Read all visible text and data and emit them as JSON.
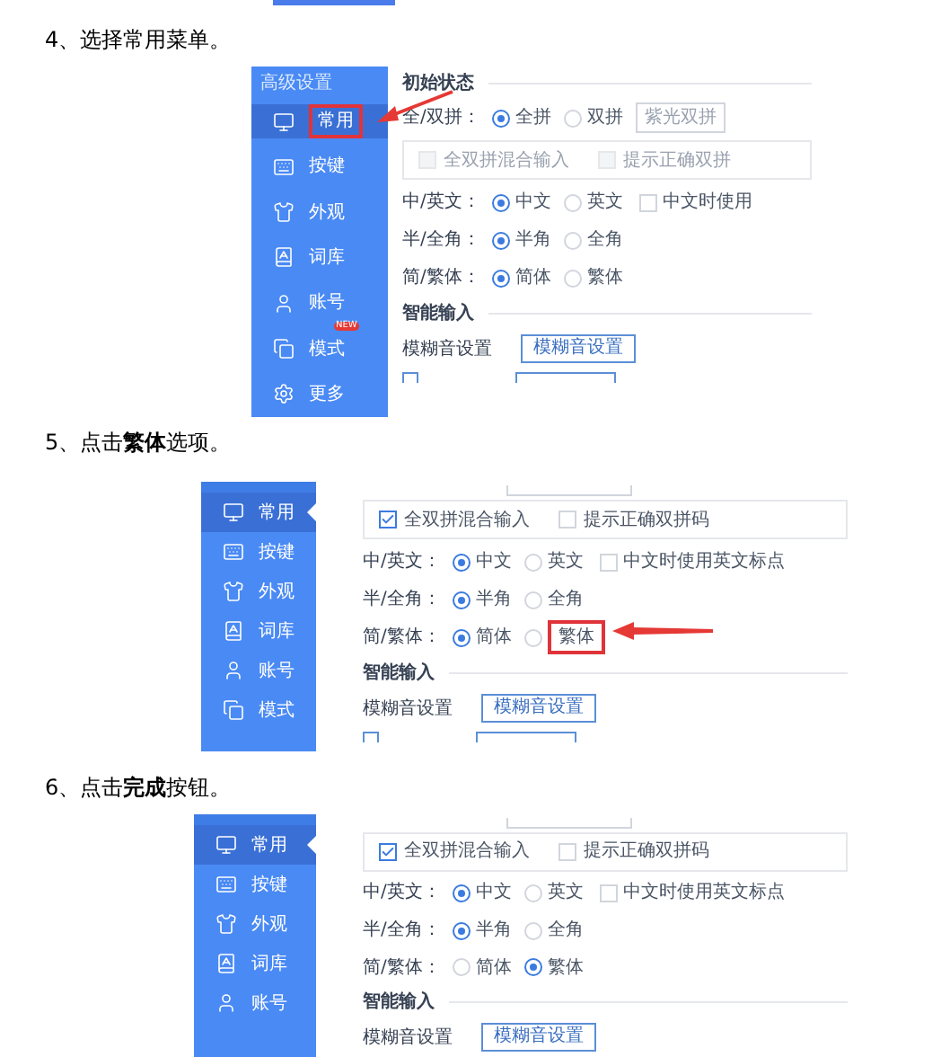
{
  "steps": [
    {
      "text": "4、选择常用菜单。",
      "shot": {
        "sidebar": {
          "title": "高级设置",
          "pointer": false,
          "items": [
            {
              "label": "常用",
              "selected": true,
              "highlighted": true
            },
            {
              "label": "按键",
              "selected": false,
              "highlighted": false
            },
            {
              "label": "外观",
              "selected": false,
              "highlighted": false
            },
            {
              "label": "词库",
              "selected": false,
              "highlighted": false
            },
            {
              "label": "账号",
              "selected": false,
              "highlighted": false
            },
            {
              "label": "模式",
              "selected": false,
              "highlighted": false,
              "badge": "NEW"
            },
            {
              "label": "更多",
              "selected": false,
              "highlighted": false
            }
          ]
        },
        "content": [
          {
            "kind": "section",
            "label": "初始状态"
          },
          {
            "kind": "radios",
            "label": "全/双拼：",
            "options": [
              {
                "label": "全拼",
                "selected": true
              },
              {
                "label": "双拼",
                "selected": false
              }
            ],
            "input": "紫光双拼"
          },
          {
            "kind": "checks",
            "disabled": true,
            "items": [
              {
                "label": "全双拼混合输入",
                "checked": false
              },
              {
                "label": "提示正确双拼",
                "checked": false
              }
            ]
          },
          {
            "kind": "radios",
            "label": "中/英文：",
            "options": [
              {
                "label": "中文",
                "selected": true
              },
              {
                "label": "英文",
                "selected": false
              }
            ],
            "check": {
              "label": "中文时使用",
              "checked": false
            }
          },
          {
            "kind": "radios",
            "label": "半/全角：",
            "options": [
              {
                "label": "半角",
                "selected": true
              },
              {
                "label": "全角",
                "selected": false
              }
            ]
          },
          {
            "kind": "radios",
            "label": "简/繁体：",
            "options": [
              {
                "label": "简体",
                "selected": true
              },
              {
                "label": "繁体",
                "selected": false
              }
            ]
          },
          {
            "kind": "section",
            "label": "智能输入"
          },
          {
            "kind": "button",
            "label": "模糊音设置",
            "button": "模糊音设置"
          },
          {
            "kind": "stub-row",
            "checked": false
          }
        ]
      }
    },
    {
      "text": "5、点击**繁体**选项。",
      "shot": {
        "sidebar": {
          "pointer": true,
          "items": [
            {
              "label": "常用",
              "selected": true,
              "highlighted": false
            },
            {
              "label": "按键",
              "selected": false,
              "highlighted": false
            },
            {
              "label": "外观",
              "selected": false,
              "highlighted": false
            },
            {
              "label": "词库",
              "selected": false,
              "highlighted": false
            },
            {
              "label": "账号",
              "selected": false,
              "highlighted": false
            },
            {
              "label": "模式",
              "selected": false,
              "highlighted": false
            }
          ]
        },
        "content": [
          {
            "kind": "stub-input"
          },
          {
            "kind": "checks",
            "disabled": false,
            "items": [
              {
                "label": "全双拼混合输入",
                "checked": true
              },
              {
                "label": "提示正确双拼码",
                "checked": false
              }
            ]
          },
          {
            "kind": "radios",
            "label": "中/英文：",
            "options": [
              {
                "label": "中文",
                "selected": true
              },
              {
                "label": "英文",
                "selected": false
              }
            ],
            "check": {
              "label": "中文时使用英文标点",
              "checked": false
            }
          },
          {
            "kind": "radios",
            "label": "半/全角：",
            "options": [
              {
                "label": "半角",
                "selected": true
              },
              {
                "label": "全角",
                "selected": false
              }
            ]
          },
          {
            "kind": "radios",
            "label": "简/繁体：",
            "options": [
              {
                "label": "简体",
                "selected": true,
                "highlighted": false
              },
              {
                "label": "繁体",
                "selected": false,
                "highlighted": true
              }
            ]
          },
          {
            "kind": "section",
            "label": "智能输入"
          },
          {
            "kind": "button",
            "label": "模糊音设置",
            "button": "模糊音设置"
          },
          {
            "kind": "stub-row",
            "checked": false
          }
        ]
      }
    },
    {
      "text": "6、点击**完成**按钮。",
      "shot": {
        "sidebar": {
          "pointer": true,
          "items": [
            {
              "label": "常用",
              "selected": true,
              "highlighted": false
            },
            {
              "label": "按键",
              "selected": false,
              "highlighted": false
            },
            {
              "label": "外观",
              "selected": false,
              "highlighted": false
            },
            {
              "label": "词库",
              "selected": false,
              "highlighted": false
            },
            {
              "label": "账号",
              "selected": false,
              "highlighted": false
            }
          ]
        },
        "content": [
          {
            "kind": "stub-input"
          },
          {
            "kind": "checks",
            "disabled": false,
            "items": [
              {
                "label": "全双拼混合输入",
                "checked": true
              },
              {
                "label": "提示正确双拼码",
                "checked": false
              }
            ]
          },
          {
            "kind": "radios",
            "label": "中/英文：",
            "options": [
              {
                "label": "中文",
                "selected": true
              },
              {
                "label": "英文",
                "selected": false
              }
            ],
            "check": {
              "label": "中文时使用英文标点",
              "checked": false
            }
          },
          {
            "kind": "radios",
            "label": "半/全角：",
            "options": [
              {
                "label": "半角",
                "selected": true
              },
              {
                "label": "全角",
                "selected": false
              }
            ]
          },
          {
            "kind": "radios",
            "label": "简/繁体：",
            "options": [
              {
                "label": "简体",
                "selected": false
              },
              {
                "label": "繁体",
                "selected": true
              }
            ]
          },
          {
            "kind": "section",
            "label": "智能输入"
          },
          {
            "kind": "button",
            "label": "模糊音设置",
            "button": "模糊音设置"
          }
        ]
      }
    }
  ]
}
